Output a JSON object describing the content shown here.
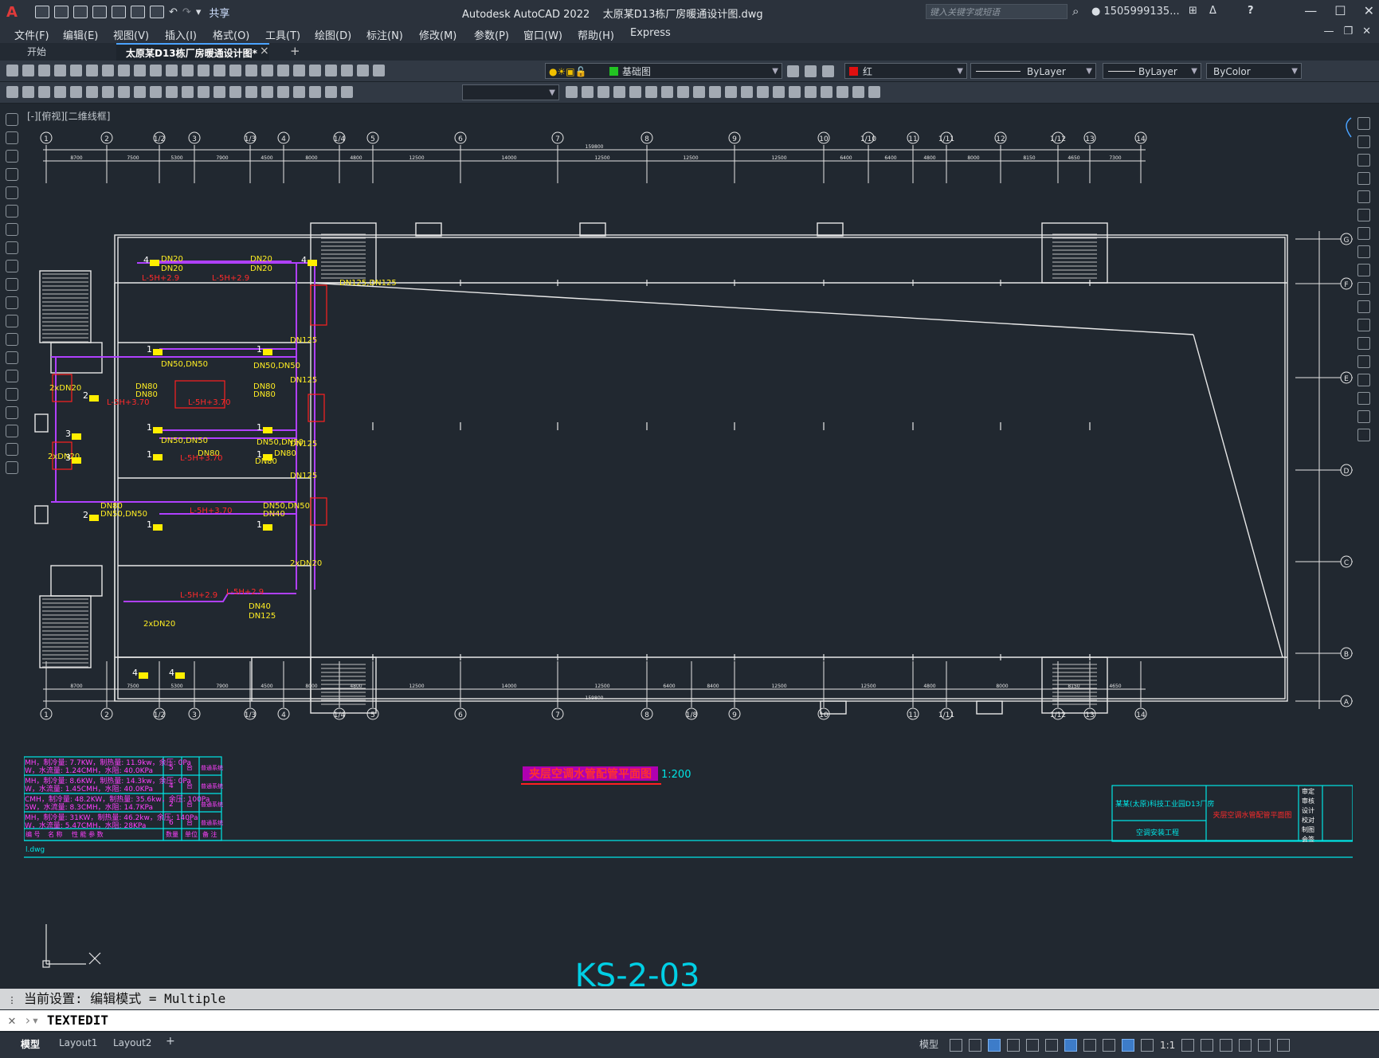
{
  "titlebar": {
    "logo": "A",
    "share": "共享",
    "app": "Autodesk AutoCAD 2022",
    "file": "太原某D13栋厂房暖通设计图.dwg",
    "search_placeholder": "键入关键字或短语",
    "user": "1505999135...",
    "help": "?"
  },
  "menu": [
    "文件(F)",
    "编辑(E)",
    "视图(V)",
    "插入(I)",
    "格式(O)",
    "工具(T)",
    "绘图(D)",
    "标注(N)",
    "修改(M)",
    "参数(P)",
    "窗口(W)",
    "帮助(H)",
    "Express"
  ],
  "tabs": {
    "start": "开始",
    "doc": "太原某D13栋厂房暖通设计图*",
    "close": "×",
    "add": "+"
  },
  "toolbar": {
    "layer": "基础图",
    "layer_color": "#22c322",
    "color": "红",
    "color_swatch": "#e01010",
    "linetype": "ByLayer",
    "lineweight": "ByLayer",
    "plotstyle": "ByColor"
  },
  "viewport_label": "[-][俯视][二维线框]",
  "drawing": {
    "axis_top": [
      "1",
      "2",
      "1/2",
      "3",
      "1/3",
      "4",
      "1/4",
      "5",
      "6",
      "7",
      "8",
      "9",
      "10",
      "1/10",
      "11",
      "1/11",
      "12",
      "1/12",
      "13",
      "14"
    ],
    "axis_bottom": [
      "1",
      "2",
      "1/2",
      "3",
      "1/3",
      "4",
      "1/4",
      "5",
      "6",
      "7",
      "8",
      "1/8",
      "9",
      "10",
      "11",
      "1/11",
      "1/12",
      "13",
      "14"
    ],
    "dims_top": [
      "8700",
      "7500",
      "5300",
      "7900",
      "4500",
      "8000",
      "4800",
      "12500",
      "14000",
      "12500",
      "12500",
      "12500",
      "6400",
      "6400",
      "4800",
      "8000",
      "8150",
      "4650",
      "7300"
    ],
    "dims_bottom": [
      "8700",
      "7500",
      "5300",
      "7900",
      "4500",
      "8000",
      "4800",
      "12500",
      "14000",
      "12500",
      "6400",
      "8400",
      "12500",
      "12500",
      "4800",
      "8000",
      "8150",
      "4650",
      "7300"
    ],
    "total_dim": "159800",
    "axis_right": [
      "G",
      "F",
      "E",
      "D",
      "C",
      "B",
      "A"
    ],
    "pipe_labels": [
      "DN20",
      "DN20",
      "DN20",
      "DN20",
      "DN125,DN125",
      "DN50,DN50",
      "DN50,DN50",
      "DN80",
      "DN80",
      "DN80",
      "DN80",
      "DN50,DN50",
      "DN50,DN50",
      "DN80",
      "DN80",
      "DN80",
      "DN80",
      "DN50,DN50",
      "DN50,DN50",
      "DN40",
      "DN40",
      "DN125",
      "DN125",
      "DN125",
      "DN125",
      "DN125",
      "2xDN20",
      "2xDN20",
      "2xDN20",
      "2xDN20"
    ],
    "elev_labels": [
      "L-5H+2.9",
      "L-5H+2.9",
      "L-5H+3.70",
      "L-5H+3.70",
      "L-5H+3.70",
      "L-5H+3.70",
      "L-5H+2.9",
      "L-5H+2.9"
    ],
    "unit_numbers": [
      "4",
      "4",
      "1",
      "1",
      "2",
      "1",
      "1",
      "3",
      "3",
      "1",
      "1",
      "2",
      "1",
      "1",
      "4",
      "4"
    ],
    "title": "夹层空调水管配管平面图",
    "scale": "1:200",
    "sheet_code": "KS-2-03",
    "schedule_rows": [
      [
        "MH，制冷量: 7.7KW，制热量: 11.9kw，余压: 0Pa",
        "W，水流量: 1.24CMH，水阻: 40.0KPa",
        "5",
        "台",
        "普通系统"
      ],
      [
        "MH，制冷量: 8.6KW，制热量: 14.3kw，余压: 0Pa",
        "W，水流量: 1.45CMH，水阻: 40.0KPa",
        "4",
        "台",
        "普通系统"
      ],
      [
        "CMH，制冷量: 48.2KW，制热量: 35.6kw，余压: 100Pa",
        "5W，水流量: 8.3CMH，水阻: 14.7KPa",
        "2",
        "台",
        "普通系统"
      ],
      [
        "MH，制冷量: 31KW，制热量: 46.2kw，余压: 140Pa",
        "W，水流量: 5.47CMH，水阻: 28KPa",
        "6",
        "台",
        "普通系统"
      ]
    ],
    "schedule_header": [
      "编  号",
      "名  称",
      "性  能  参  数",
      "数量",
      "单位",
      "备  注"
    ],
    "titleblock": {
      "project": "某某(太原)科技工业园D13厂房",
      "subproject": "空调安装工程",
      "drawing": "夹层空调水管配管平面图",
      "roles": [
        "审定",
        "审核",
        "设计",
        "校对",
        "制图",
        "会签"
      ]
    },
    "ucs_note": "l.dwg"
  },
  "cmd": {
    "history": "当前设置: 编辑模式 = Multiple",
    "prompt": "TEXTEDIT"
  },
  "status": {
    "model": "模型",
    "layout1": "Layout1",
    "layout2": "Layout2",
    "add": "+",
    "model_btn": "模型",
    "scale": "1:1"
  }
}
